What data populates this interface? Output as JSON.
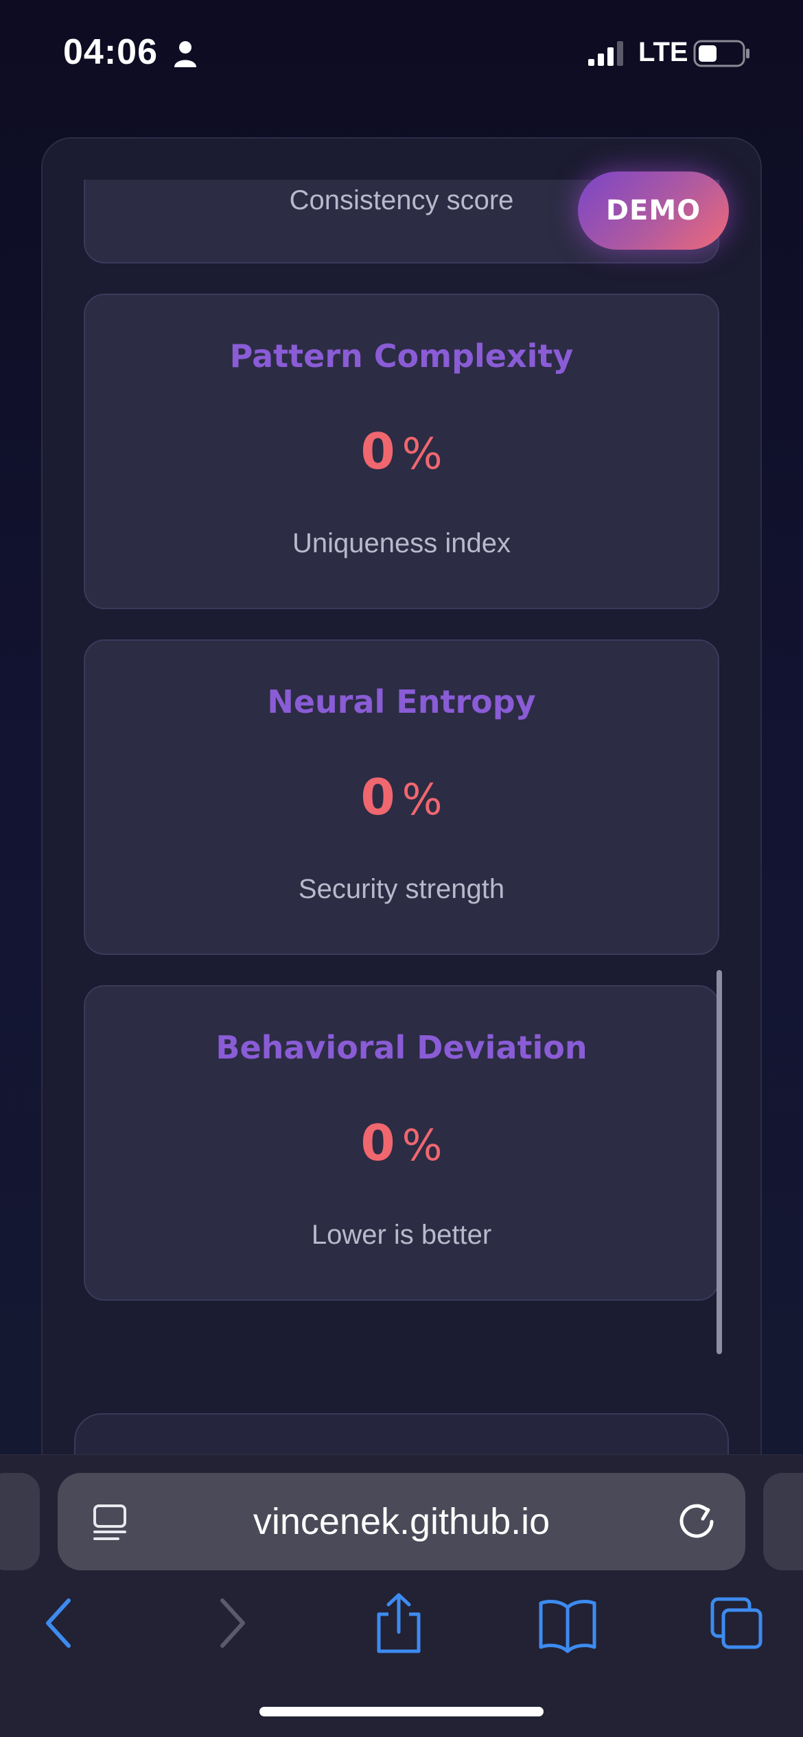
{
  "status_bar": {
    "time": "04:06",
    "carrier": "LTE",
    "icons": [
      "person-icon",
      "signal-icon",
      "battery-icon"
    ]
  },
  "panel": {
    "top_card": {
      "subtitle": "Consistency score"
    },
    "demo_badge": "DEMO",
    "cards": [
      {
        "title": "Pattern Complexity",
        "value": "0",
        "unit": "%",
        "subtitle": "Uniqueness index"
      },
      {
        "title": "Neural Entropy",
        "value": "0",
        "unit": "%",
        "subtitle": "Security strength"
      },
      {
        "title": "Behavioral Deviation",
        "value": "0",
        "unit": "%",
        "subtitle": "Lower is better"
      }
    ]
  },
  "browser": {
    "url": "vincenek.github.io",
    "toolbar_icons": [
      "back-icon",
      "forward-icon",
      "share-icon",
      "bookmarks-icon",
      "tabs-icon"
    ]
  },
  "colors": {
    "accent_purple": "#8a5cd6",
    "value_red": "#f0676f",
    "safari_blue": "#3d8bf0"
  }
}
